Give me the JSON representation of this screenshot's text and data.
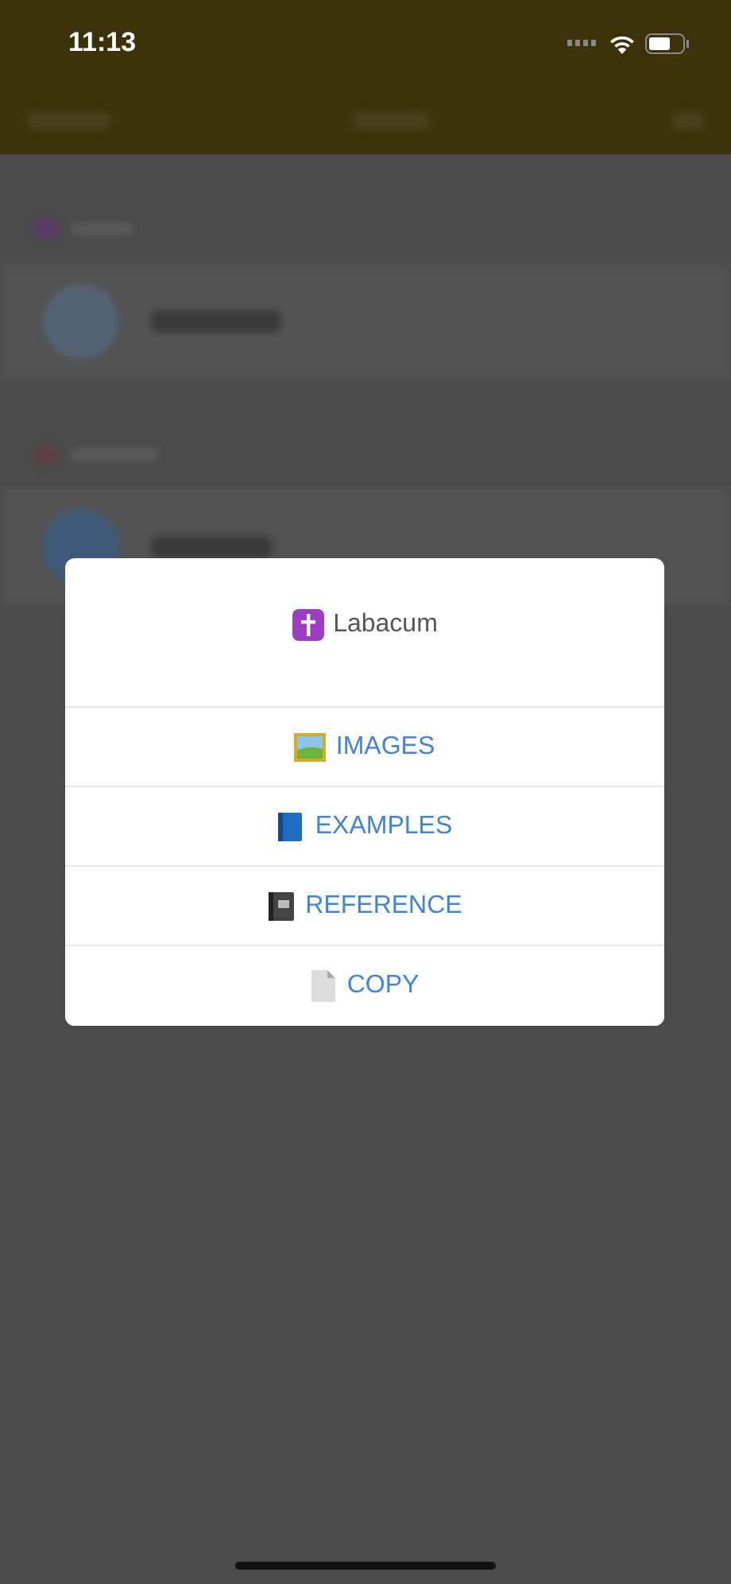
{
  "status_bar": {
    "time": "11:13"
  },
  "dialog": {
    "title": "Labacum",
    "actions": [
      {
        "label": "IMAGES",
        "kind": "picture"
      },
      {
        "label": "EXAMPLES",
        "kind": "book"
      },
      {
        "label": "REFERENCE",
        "kind": "ledger"
      },
      {
        "label": "COPY",
        "kind": "document"
      }
    ]
  }
}
